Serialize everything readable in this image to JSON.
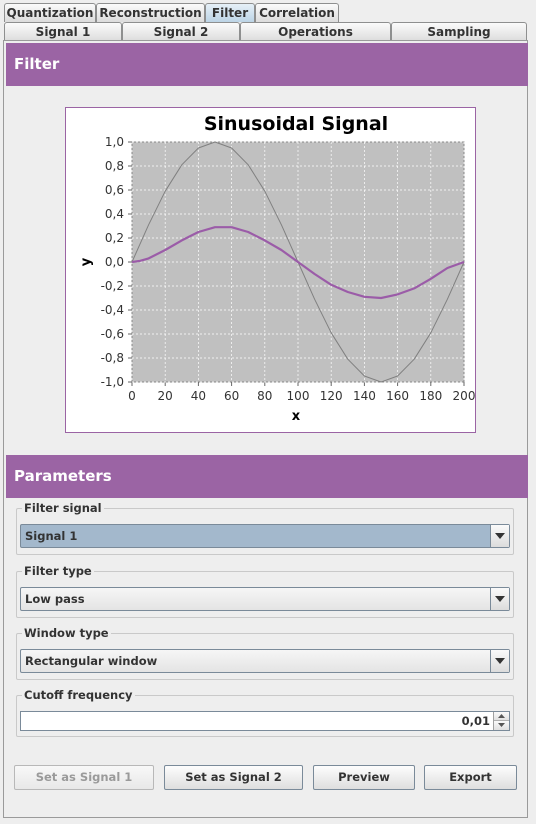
{
  "tabs_top": [
    {
      "label": "Quantization",
      "active": false
    },
    {
      "label": "Reconstruction",
      "active": false
    },
    {
      "label": "Filter",
      "active": true
    },
    {
      "label": "Correlation",
      "active": false
    }
  ],
  "tabs_bottom": [
    {
      "label": "Signal 1"
    },
    {
      "label": "Signal 2"
    },
    {
      "label": "Operations"
    },
    {
      "label": "Sampling"
    }
  ],
  "filter_header": "Filter",
  "parameters_header": "Parameters",
  "chart_data": {
    "type": "line",
    "title": "Sinusoidal Signal",
    "xlabel": "x",
    "ylabel": "y",
    "xlim": [
      0,
      200
    ],
    "ylim": [
      -1.0,
      1.0
    ],
    "x_ticks": [
      "0",
      "20",
      "40",
      "60",
      "80",
      "100",
      "120",
      "140",
      "160",
      "180",
      "200"
    ],
    "y_ticks": [
      "1,0",
      "0,8",
      "0,6",
      "0,4",
      "0,2",
      "0,0",
      "-0,2",
      "-0,4",
      "-0,6",
      "-0,8",
      "-1,0"
    ],
    "grid": true,
    "series": [
      {
        "color": "#808080",
        "points": [
          [
            0,
            0
          ],
          [
            10,
            0.31
          ],
          [
            20,
            0.59
          ],
          [
            30,
            0.81
          ],
          [
            40,
            0.95
          ],
          [
            50,
            1.0
          ],
          [
            60,
            0.95
          ],
          [
            70,
            0.81
          ],
          [
            80,
            0.59
          ],
          [
            90,
            0.31
          ],
          [
            100,
            0
          ],
          [
            110,
            -0.31
          ],
          [
            120,
            -0.59
          ],
          [
            130,
            -0.81
          ],
          [
            140,
            -0.95
          ],
          [
            150,
            -1.0
          ],
          [
            160,
            -0.95
          ],
          [
            170,
            -0.81
          ],
          [
            180,
            -0.59
          ],
          [
            190,
            -0.31
          ],
          [
            200,
            0
          ]
        ]
      },
      {
        "color": "#9b5ca8",
        "points": [
          [
            0,
            0
          ],
          [
            5,
            0.01
          ],
          [
            10,
            0.03
          ],
          [
            20,
            0.1
          ],
          [
            30,
            0.18
          ],
          [
            40,
            0.25
          ],
          [
            50,
            0.29
          ],
          [
            60,
            0.29
          ],
          [
            70,
            0.25
          ],
          [
            80,
            0.18
          ],
          [
            90,
            0.1
          ],
          [
            100,
            0
          ],
          [
            110,
            -0.1
          ],
          [
            120,
            -0.19
          ],
          [
            130,
            -0.25
          ],
          [
            140,
            -0.29
          ],
          [
            150,
            -0.3
          ],
          [
            160,
            -0.27
          ],
          [
            170,
            -0.22
          ],
          [
            180,
            -0.14
          ],
          [
            190,
            -0.05
          ],
          [
            200,
            0
          ]
        ]
      }
    ]
  },
  "filter_signal": {
    "label": "Filter signal",
    "value": "Signal 1"
  },
  "filter_type": {
    "label": "Filter type",
    "value": "Low pass"
  },
  "window_type": {
    "label": "Window type",
    "value": "Rectangular window"
  },
  "cutoff": {
    "label": "Cutoff frequency",
    "value": "0,01"
  },
  "buttons": {
    "set_signal1": "Set as Signal 1",
    "set_signal2": "Set as Signal 2",
    "preview": "Preview",
    "export": "Export"
  },
  "colors": {
    "accent": "#9b64a4",
    "selected": "#a3b8cc"
  }
}
